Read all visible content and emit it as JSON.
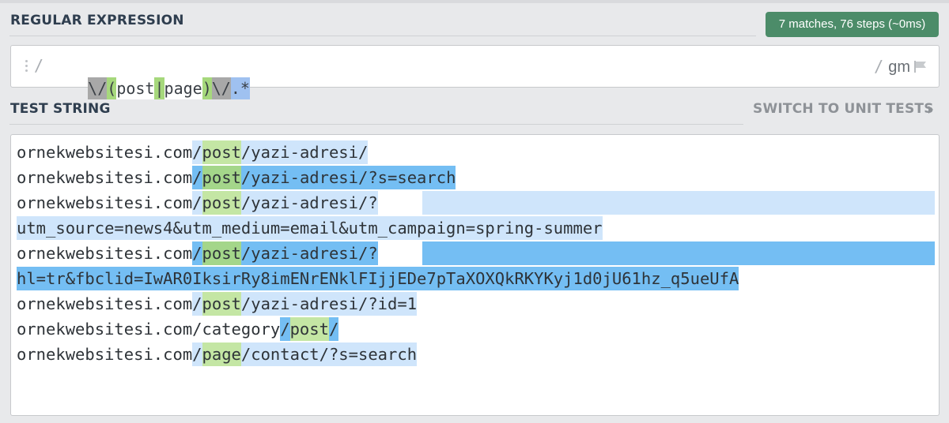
{
  "regex_section": {
    "title": "REGULAR EXPRESSION",
    "match_info": "7 matches, 76 steps (~0ms)",
    "delimiter_open": "/",
    "delimiter_close": "/",
    "flags": "gm",
    "expression_tokens": [
      "\\/",
      "(",
      "post",
      "|",
      "page",
      ")",
      "\\/",
      ".*"
    ]
  },
  "test_section": {
    "title": "TEST STRING",
    "switch_label": "SWITCH TO UNIT TESTS",
    "lines": [
      {
        "pre": "ornekwebsitesi.com",
        "slash": "/",
        "group": "post",
        "rest": "/yazi-adresi/"
      },
      {
        "pre": "ornekwebsitesi.com",
        "slash": "/",
        "group": "post",
        "rest": "/yazi-adresi/?s=search"
      },
      {
        "pre": "ornekwebsitesi.com",
        "slash": "/",
        "group": "post",
        "rest": "/yazi-adresi/?"
      },
      {
        "pre": "",
        "slash": "",
        "group": "",
        "rest": "utm_source=news4&utm_medium=email&utm_campaign=spring-summer"
      },
      {
        "pre": "ornekwebsitesi.com",
        "slash": "/",
        "group": "post",
        "rest": "/yazi-adresi/?"
      },
      {
        "pre": "",
        "slash": "",
        "group": "",
        "rest": "hl=tr&fbclid=IwAR0IksirRy8imENrENklFIjjEDe7pTaXOXQkRKYKyj1d0jU61hz_q5ueUfA"
      },
      {
        "pre": "ornekwebsitesi.com",
        "slash": "/",
        "group": "post",
        "rest": "/yazi-adresi/?id=1"
      },
      {
        "pre": "ornekwebsitesi.com/category",
        "slash": "/",
        "group": "post",
        "rest": "/"
      },
      {
        "pre": "ornekwebsitesi.com",
        "slash": "/",
        "group": "page",
        "rest": "/contact/?s=search"
      }
    ]
  },
  "colors": {
    "match_light": "#cfe5fb",
    "match_dark": "#74bef3",
    "group_light": "#c4e6a4",
    "group_dark": "#a4d68a",
    "badge": "#4c8c69"
  },
  "icons": [
    "drag-handle-icon",
    "flag-icon",
    "chevron-right-icon"
  ]
}
